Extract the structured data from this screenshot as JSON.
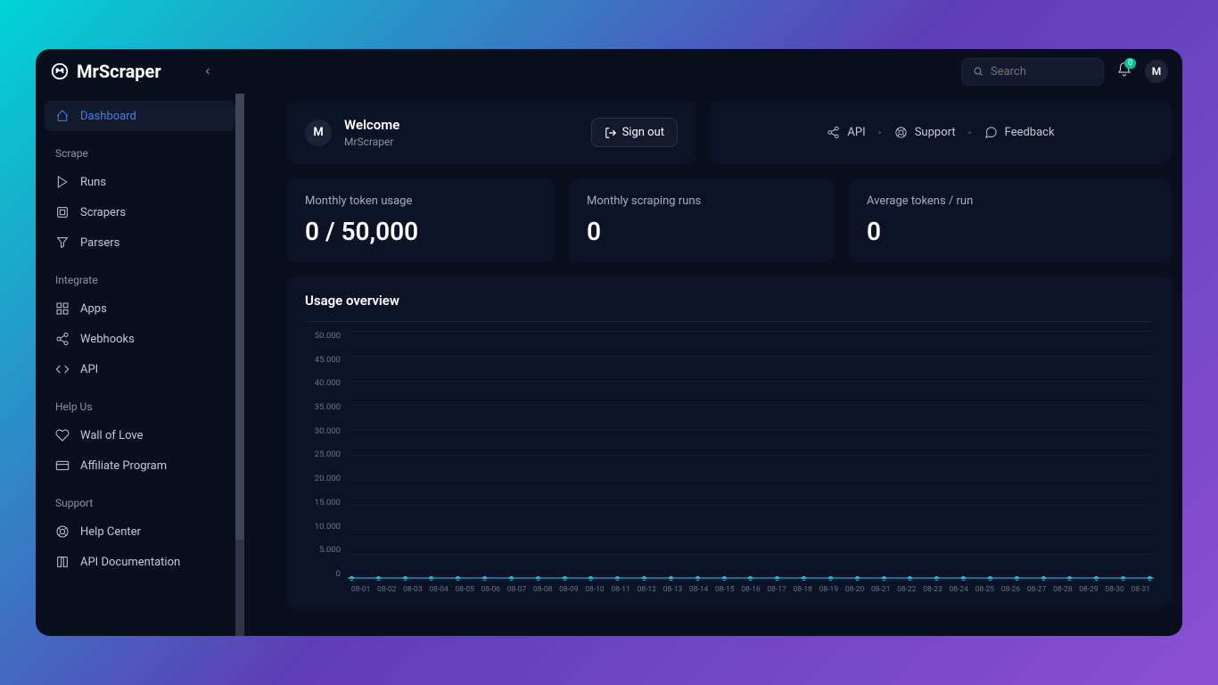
{
  "brand": "MrScraper",
  "search": {
    "placeholder": "Search"
  },
  "notifications": {
    "count": "0"
  },
  "avatar_initial": "M",
  "sidebar": {
    "items": [
      {
        "label": "Dashboard",
        "icon": "home-icon",
        "active": true
      },
      {
        "section": "Scrape"
      },
      {
        "label": "Runs",
        "icon": "play-icon"
      },
      {
        "label": "Scrapers",
        "icon": "layers-icon"
      },
      {
        "label": "Parsers",
        "icon": "funnel-icon"
      },
      {
        "section": "Integrate"
      },
      {
        "label": "Apps",
        "icon": "grid-icon"
      },
      {
        "label": "Webhooks",
        "icon": "share-icon"
      },
      {
        "label": "API",
        "icon": "code-icon"
      },
      {
        "section": "Help Us"
      },
      {
        "label": "Wall of Love",
        "icon": "heart-icon"
      },
      {
        "label": "Affiliate Program",
        "icon": "card-icon"
      },
      {
        "section": "Support"
      },
      {
        "label": "Help Center",
        "icon": "lifebuoy-icon"
      },
      {
        "label": "API Documentation",
        "icon": "book-icon"
      }
    ]
  },
  "welcome": {
    "title": "Welcome",
    "subtitle": "MrScraper",
    "initial": "M",
    "signout": "Sign out"
  },
  "quicklinks": {
    "api": "API",
    "support": "Support",
    "feedback": "Feedback"
  },
  "stats": [
    {
      "label": "Monthly token usage",
      "value": "0 / 50,000"
    },
    {
      "label": "Monthly scraping runs",
      "value": "0"
    },
    {
      "label": "Average tokens / run",
      "value": "0"
    }
  ],
  "chart_title": "Usage overview",
  "chart_data": {
    "type": "line",
    "title": "Usage overview",
    "xlabel": "",
    "ylabel": "",
    "ylim": [
      0,
      50000
    ],
    "y_ticks": [
      "50.000",
      "45.000",
      "40.000",
      "35.000",
      "30.000",
      "25.000",
      "20.000",
      "15.000",
      "10.000",
      "5.000",
      "0"
    ],
    "categories": [
      "08-01",
      "08-02",
      "08-03",
      "08-04",
      "08-05",
      "08-06",
      "08-07",
      "08-08",
      "08-09",
      "08-10",
      "08-11",
      "08-12",
      "08-13",
      "08-14",
      "08-15",
      "08-16",
      "08-17",
      "08-18",
      "08-19",
      "08-20",
      "08-21",
      "08-22",
      "08-23",
      "08-24",
      "08-25",
      "08-26",
      "08-27",
      "08-28",
      "08-29",
      "08-30",
      "08-31"
    ],
    "values": [
      0,
      0,
      0,
      0,
      0,
      0,
      0,
      0,
      0,
      0,
      0,
      0,
      0,
      0,
      0,
      0,
      0,
      0,
      0,
      0,
      0,
      0,
      0,
      0,
      0,
      0,
      0,
      0,
      0,
      0,
      0
    ]
  }
}
